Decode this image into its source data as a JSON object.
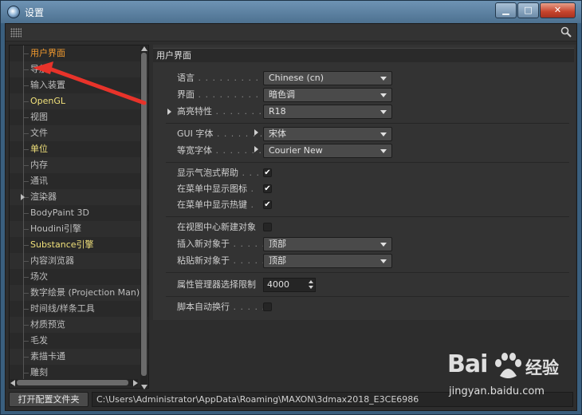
{
  "window": {
    "title": "设置",
    "controls": {
      "minimize": "▁",
      "maximize": "□",
      "close": "✕"
    }
  },
  "toolbar": {
    "icons": [
      "grip-icon",
      "search-icon"
    ]
  },
  "tree": {
    "items": [
      {
        "label": "用户界面",
        "color": "orange"
      },
      {
        "label": "导航",
        "color": "normal"
      },
      {
        "label": "输入装置",
        "color": "normal"
      },
      {
        "label": "OpenGL",
        "color": "yellow"
      },
      {
        "label": "视图",
        "color": "normal"
      },
      {
        "label": "文件",
        "color": "normal"
      },
      {
        "label": "单位",
        "color": "yellow"
      },
      {
        "label": "内存",
        "color": "normal"
      },
      {
        "label": "通讯",
        "color": "normal"
      },
      {
        "label": "渲染器",
        "color": "normal",
        "expandable": true
      },
      {
        "label": "BodyPaint 3D",
        "color": "normal"
      },
      {
        "label": "Houdini引擎",
        "color": "normal"
      },
      {
        "label": "Substance引擎",
        "color": "yellow"
      },
      {
        "label": "内容浏览器",
        "color": "normal"
      },
      {
        "label": "场次",
        "color": "normal"
      },
      {
        "label": "数字绘景 (Projection Man)",
        "color": "normal"
      },
      {
        "label": "时间线/样条工具",
        "color": "normal"
      },
      {
        "label": "材质预览",
        "color": "normal"
      },
      {
        "label": "毛发",
        "color": "normal"
      },
      {
        "label": "素描卡通",
        "color": "normal"
      },
      {
        "label": "雕刻",
        "color": "normal"
      }
    ]
  },
  "panel": {
    "header": "用户界面",
    "language": {
      "label": "语言",
      "dots": " . . . . . . . . . . . .",
      "value": "Chinese (cn)"
    },
    "scheme": {
      "label": "界面",
      "dots": " . . . . . . . . . . . .",
      "value": "暗色调"
    },
    "highlight": {
      "label": "高亮特性",
      "dots": " . . . . . . . . .",
      "value": "R18"
    },
    "gui_font": {
      "label": "GUI 字体",
      "dots": " . . . . . . .",
      "value": "宋体"
    },
    "mono_font": {
      "label": "等宽字体",
      "dots": " . . . . . . .",
      "value": "Courier New"
    },
    "bubble_help": {
      "label": "显示气泡式帮助",
      "dots": " . . .",
      "check": "✔"
    },
    "menu_icons": {
      "label": "在菜单中显示图标",
      "dots": " .",
      "check": "✔"
    },
    "menu_hotkeys": {
      "label": "在菜单中显示热键",
      "dots": " .",
      "check": "✔"
    },
    "new_obj_center": {
      "label": "在视图中心新建对象",
      "dots": "",
      "check": ""
    },
    "insert_obj": {
      "label": "插入新对象于",
      "dots": " . . . . .",
      "value": "顶部"
    },
    "paste_obj": {
      "label": "粘贴新对象于",
      "dots": " . . . . .",
      "value": "顶部"
    },
    "attr_limit": {
      "label": "属性管理器选择限制",
      "dots": "",
      "value": "4000"
    },
    "script_wrap": {
      "label": "脚本自动换行",
      "dots": " . . . . .",
      "check": ""
    }
  },
  "bottom": {
    "open_folder": "打开配置文件夹",
    "path": "C:\\Users\\Administrator\\AppData\\Roaming\\MAXON\\3dmax2018_E3CE6986"
  },
  "watermark": {
    "logo": "Bai",
    "logo2": "经验",
    "url": "jingyan.baidu.com"
  },
  "colors": {
    "accent_orange": "#f29a2e",
    "accent_yellow": "#f0e07a",
    "annotation_red": "#e8332a"
  }
}
